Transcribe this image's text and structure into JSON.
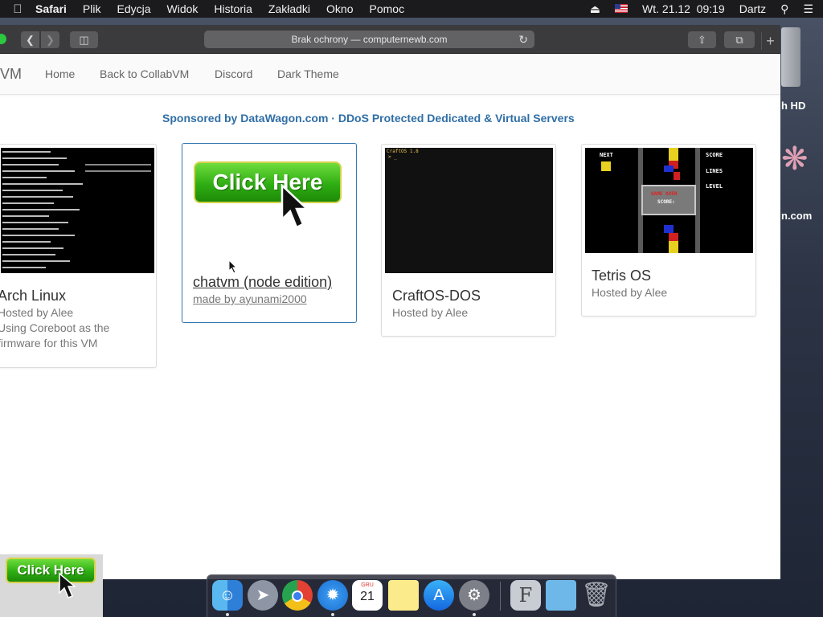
{
  "menubar": {
    "app_name": "Safari",
    "menus": [
      "Plik",
      "Edycja",
      "Widok",
      "Historia",
      "Zakładki",
      "Okno",
      "Pomoc"
    ],
    "datetime": "Wt. 21.12  09:19",
    "user": "Dartz"
  },
  "browser": {
    "url_text": "Brak ochrony — computernewb.com"
  },
  "site": {
    "brand": "VM",
    "nav": [
      "Home",
      "Back to CollabVM",
      "Discord",
      "Dark Theme"
    ],
    "sponsor": "Sponsored by DataWagon.com · DDoS Protected Dedicated & Virtual Servers"
  },
  "cards": [
    {
      "title": "Arch Linux",
      "sub_lines": [
        "Hosted by Alee",
        "Using Coreboot as the",
        "firmware for this VM"
      ]
    },
    {
      "title": "chatvm (node edition)",
      "sub_lines": [
        "made by ayunami2000"
      ],
      "thumb_button": "Click Here"
    },
    {
      "title": "CraftOS-DOS",
      "sub_lines": [
        "Hosted by Alee"
      ],
      "thumb_text": "CraftOS 1.8"
    },
    {
      "title": "Tetris OS",
      "sub_lines": [
        "Hosted by Alee"
      ],
      "thumb_labels": [
        "NEXT",
        "SCORE",
        "LINES",
        "LEVEL",
        "GAME OVER",
        "SCORE:"
      ]
    }
  ],
  "float_button": "Click Here",
  "desktop": {
    "labels": [
      "h HD",
      "n.com"
    ]
  },
  "dock": {
    "calendar_month": "GRU",
    "calendar_day": "21"
  },
  "colors": {
    "sponsor": "#2f6ea5",
    "active_card_border": "#3476b3",
    "button_green": "#2fae14"
  }
}
